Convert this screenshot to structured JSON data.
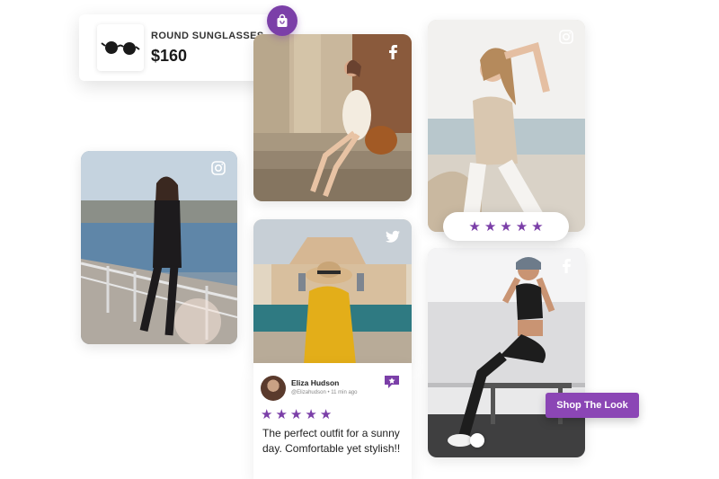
{
  "product": {
    "name": "ROUND SUNGLASSES",
    "price": "$160",
    "thumb_icon": "sunglasses-icon",
    "badge_icon": "shopping-bag-icon"
  },
  "posts": [
    {
      "id": "sitting-stairs",
      "platform_icon": "facebook-icon"
    },
    {
      "id": "woman-beach",
      "platform_icon": "instagram-icon"
    },
    {
      "id": "woman-bridge",
      "platform_icon": "instagram-icon"
    },
    {
      "id": "woman-hat",
      "platform_icon": "twitter-icon"
    },
    {
      "id": "woman-gym",
      "platform_icon": "facebook-icon"
    }
  ],
  "rating": {
    "stars": 5
  },
  "review": {
    "name": "Eliza Hudson",
    "meta": "@Elizahudson • 11 min ago",
    "stars": 5,
    "text": "The perfect outfit for a sunny day. Comfortable yet stylish!!",
    "badge_icon": "review-star-icon"
  },
  "shop_button": {
    "label": "Shop The Look"
  },
  "colors": {
    "accent": "#7b3fa8",
    "button": "#8b46b5"
  }
}
